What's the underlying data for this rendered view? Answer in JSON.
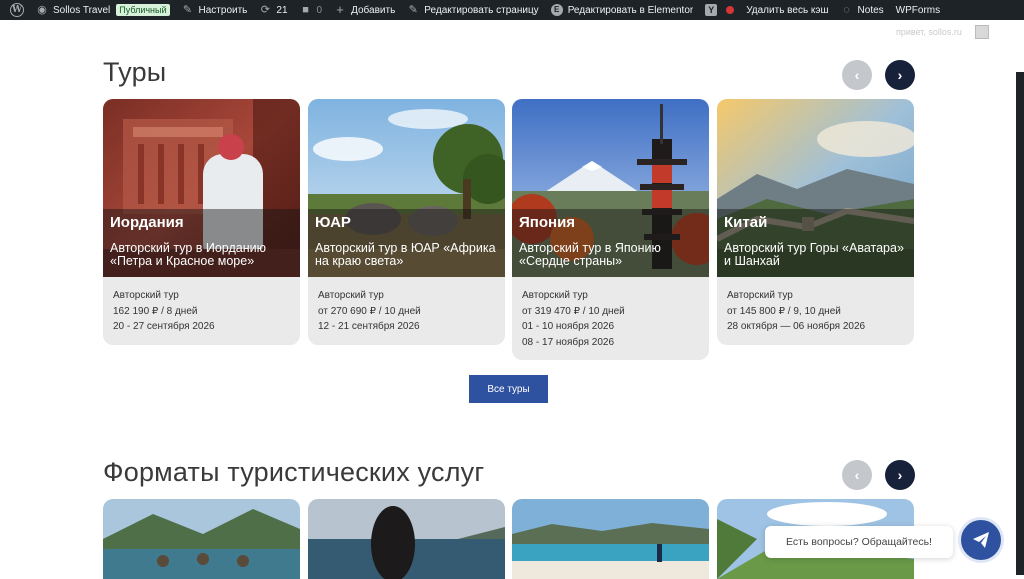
{
  "adminbar": {
    "site_name": "Sollos Travel",
    "public_badge": "Публичный",
    "customize": "Настроить",
    "updates_count": "21",
    "comments_count": "0",
    "add_new": "Добавить",
    "edit_page": "Редактировать страницу",
    "edit_elementor": "Редактировать в Elementor",
    "clear_cache": "Удалить весь кэш",
    "notes": "Notes",
    "wpforms": "WPForms"
  },
  "user": {
    "name": "привет, sollos.ru"
  },
  "tours": {
    "title": "Туры",
    "all_button": "Все туры",
    "cards": [
      {
        "country": "Иордания",
        "subtitle": "Авторский тур в Иорданию «Петра и Красное море»",
        "type": "Авторский тур",
        "price": "162 190 ₽ / 8 дней",
        "dates": [
          "20 - 27 сентября 2026"
        ]
      },
      {
        "country": "ЮАР",
        "subtitle": "Авторский тур в ЮАР «Африка на краю света»",
        "type": "Авторский тур",
        "price": "от 270 690 ₽ / 10 дней",
        "dates": [
          "12 - 21 сентября 2026"
        ]
      },
      {
        "country": "Япония",
        "subtitle": "Авторский тур в Японию «Сердце страны»",
        "type": "Авторский тур",
        "price": "от 319 470 ₽ / 10 дней",
        "dates": [
          "01 - 10 ноября 2026",
          "08 - 17 ноября 2026"
        ]
      },
      {
        "country": "Китай",
        "subtitle": "Авторский тур Горы «Аватара» и Шанхай",
        "type": "Авторский тур",
        "price": "от 145 800 ₽ / 9, 10 дней",
        "dates": [
          "28 октября — 06 ноября 2026"
        ]
      }
    ]
  },
  "formats": {
    "title": "Форматы туристических услуг"
  },
  "chat": {
    "bubble": "Есть вопросы? Обращайтесь!"
  },
  "colors": {
    "adminbar_bg": "#1d2327",
    "nav_next": "#17213a",
    "nav_prev": "#c4c7cc",
    "primary_button": "#2f52a0",
    "card_bg": "#eaeaea"
  }
}
